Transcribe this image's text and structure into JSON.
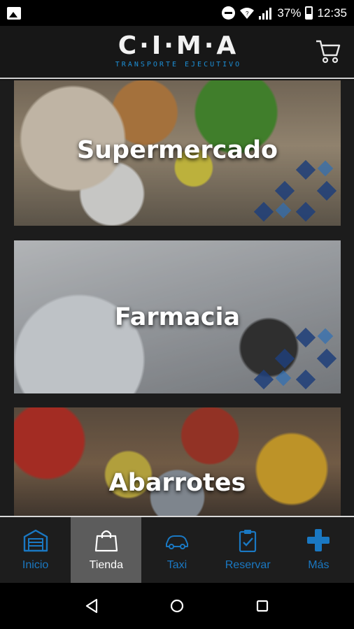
{
  "status_bar": {
    "battery": "37%",
    "time": "12:35"
  },
  "header": {
    "logo_main": "C·I·M·A",
    "logo_sub": "TRANSPORTE EJECUTIVO"
  },
  "categories": [
    {
      "label": "Supermercado"
    },
    {
      "label": "Farmacia"
    },
    {
      "label": "Abarrotes"
    }
  ],
  "tabs": [
    {
      "label": "Inicio",
      "icon": "garage-icon",
      "active": false
    },
    {
      "label": "Tienda",
      "icon": "shopping-bag-icon",
      "active": true
    },
    {
      "label": "Taxi",
      "icon": "car-icon",
      "active": false
    },
    {
      "label": "Reservar",
      "icon": "clipboard-check-icon",
      "active": false
    },
    {
      "label": "Más",
      "icon": "plus-icon",
      "active": false
    }
  ],
  "colors": {
    "accent": "#1a78c2",
    "active_tab": "#5c5c5c"
  }
}
